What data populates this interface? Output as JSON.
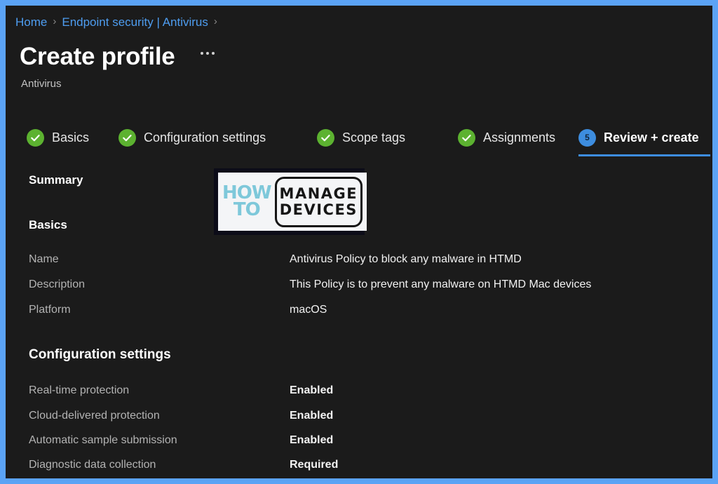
{
  "theme": {
    "frame_border_color": "#5ba3f5",
    "background": "#1b1b1b",
    "link_color": "#4e9df0",
    "accent_blue": "#3d8ddf",
    "success_green": "#5cb230",
    "label_color": "#b3b3b3",
    "value_color": "#f2f2f2"
  },
  "breadcrumb": {
    "items": [
      {
        "label": "Home",
        "separator": "›"
      },
      {
        "label": "Endpoint security | Antivirus",
        "separator": "›"
      }
    ]
  },
  "header": {
    "title": "Create profile",
    "subtitle": "Antivirus",
    "more_options": "…"
  },
  "wizard": {
    "steps": [
      {
        "label": "Basics",
        "state": "done",
        "badge": "✓"
      },
      {
        "label": "Configuration settings",
        "state": "done",
        "badge": "✓"
      },
      {
        "label": "Scope tags",
        "state": "done",
        "badge": "✓"
      },
      {
        "label": "Assignments",
        "state": "done",
        "badge": "✓"
      },
      {
        "label": "Review + create",
        "state": "current",
        "badge": "5"
      }
    ]
  },
  "summary": {
    "heading": "Summary",
    "basics": {
      "heading": "Basics",
      "rows": [
        {
          "key": "Name",
          "value": "Antivirus Policy to block any malware in HTMD"
        },
        {
          "key": "Description",
          "value": "This Policy is to prevent any malware on HTMD Mac devices"
        },
        {
          "key": "Platform",
          "value": "macOS"
        }
      ]
    },
    "configuration_settings": {
      "heading": "Configuration settings",
      "rows": [
        {
          "key": "Real-time protection",
          "value": "Enabled"
        },
        {
          "key": "Cloud-delivered protection",
          "value": "Enabled"
        },
        {
          "key": "Automatic sample submission",
          "value": "Enabled"
        },
        {
          "key": "Diagnostic data collection",
          "value": "Required"
        }
      ]
    }
  },
  "watermark": {
    "line_how": "HOW",
    "line_to": "TO",
    "line_manage": "MANAGE",
    "line_devices": "DEVICES"
  }
}
